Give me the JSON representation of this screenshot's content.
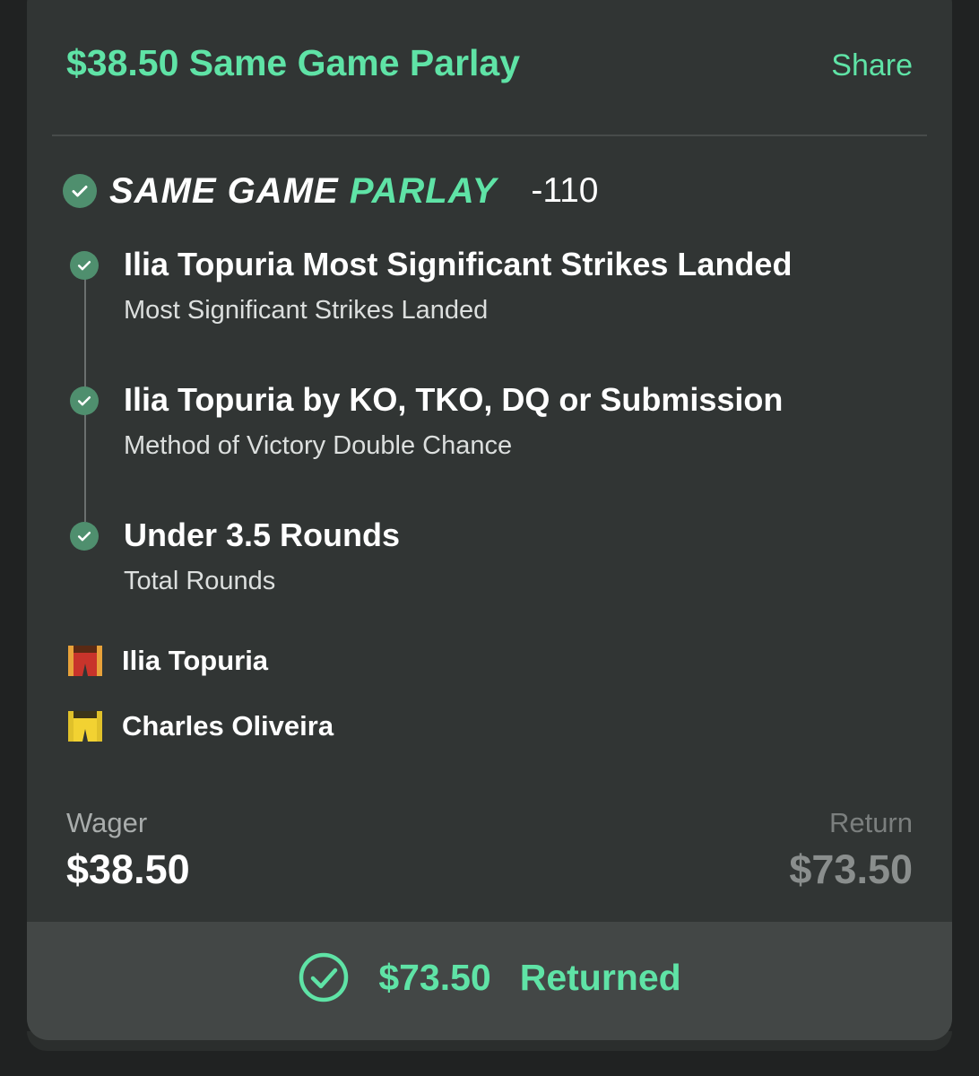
{
  "header": {
    "title": "$38.50 Same Game Parlay",
    "share_label": "Share"
  },
  "parlay": {
    "label_plain": "SAME GAME",
    "label_accent": "PARLAY",
    "odds": "-110"
  },
  "legs": [
    {
      "title": "Ilia Topuria Most Significant Strikes Landed",
      "subtitle": "Most Significant Strikes Landed"
    },
    {
      "title": "Ilia Topuria by KO, TKO, DQ or Submission",
      "subtitle": "Method of Victory Double Chance"
    },
    {
      "title": "Under 3.5 Rounds",
      "subtitle": "Total Rounds"
    }
  ],
  "fighters": [
    {
      "name": "Ilia Topuria",
      "icon": "red-shorts-icon",
      "color": "#c8342b"
    },
    {
      "name": "Charles Oliveira",
      "icon": "yellow-shorts-icon",
      "color": "#f2d232"
    }
  ],
  "wager": {
    "label": "Wager",
    "value": "$38.50"
  },
  "return": {
    "label": "Return",
    "value": "$73.50"
  },
  "status": {
    "amount": "$73.50",
    "text": "Returned"
  },
  "colors": {
    "accent": "#5fe3a6",
    "card": "#313534",
    "success_check": "#4f8f6e"
  }
}
